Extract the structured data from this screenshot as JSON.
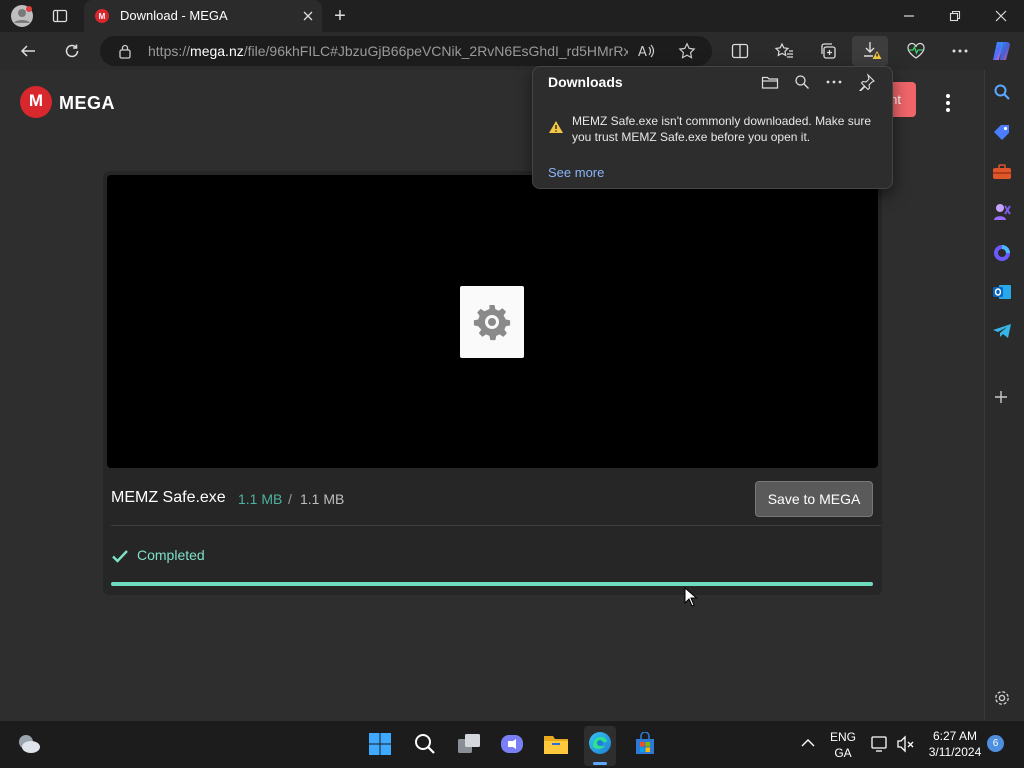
{
  "browser": {
    "tab_title": "Download - MEGA",
    "new_tab_symbol": "+",
    "address": {
      "url_prefix": "https://",
      "url_host": "mega.nz",
      "url_path": "/file/96khFILC#JbzuGjB66peVCNik_2RvN6EsGhdI_rd5HMrRx..."
    }
  },
  "mega": {
    "logo_letter": "M",
    "logo_text": "MEGA",
    "header_button_peek": "nt"
  },
  "file": {
    "name": "MEMZ Safe.exe",
    "downloaded": "1.1 MB",
    "separator": "/",
    "total": "1.1 MB",
    "save_button": "Save to MEGA",
    "status": "Completed",
    "progress_fraction": 1.0
  },
  "downloads_panel": {
    "title": "Downloads",
    "warning": "MEMZ Safe.exe isn't commonly downloaded. Make sure you trust MEMZ Safe.exe before you open it.",
    "see_more": "See more"
  },
  "taskbar": {
    "language_line1": "ENG",
    "language_line2": "GA",
    "time": "6:27 AM",
    "date": "3/11/2024",
    "notification_count": "6"
  },
  "colors": {
    "mega_red": "#d9272e",
    "progress": "#6fdcbf",
    "status_text": "#7fe0c8",
    "link": "#8ab4f8",
    "warning": "#f2c744"
  },
  "icons": {
    "toolbar_left": [
      "back-arrow-icon",
      "refresh-icon",
      "lock-icon"
    ],
    "toolbar_right": [
      "read-aloud-icon",
      "favorite-star-icon",
      "split-screen-icon",
      "favorites-icon",
      "collections-icon",
      "downloads-icon",
      "browser-essentials-icon",
      "more-icon",
      "copilot-icon"
    ],
    "sidebar": [
      "search-icon",
      "shopping-tag-icon",
      "tools-icon",
      "games-icon",
      "copilot-sidebar-icon",
      "outlook-icon",
      "telegram-icon",
      "add-icon",
      "settings-icon"
    ]
  }
}
